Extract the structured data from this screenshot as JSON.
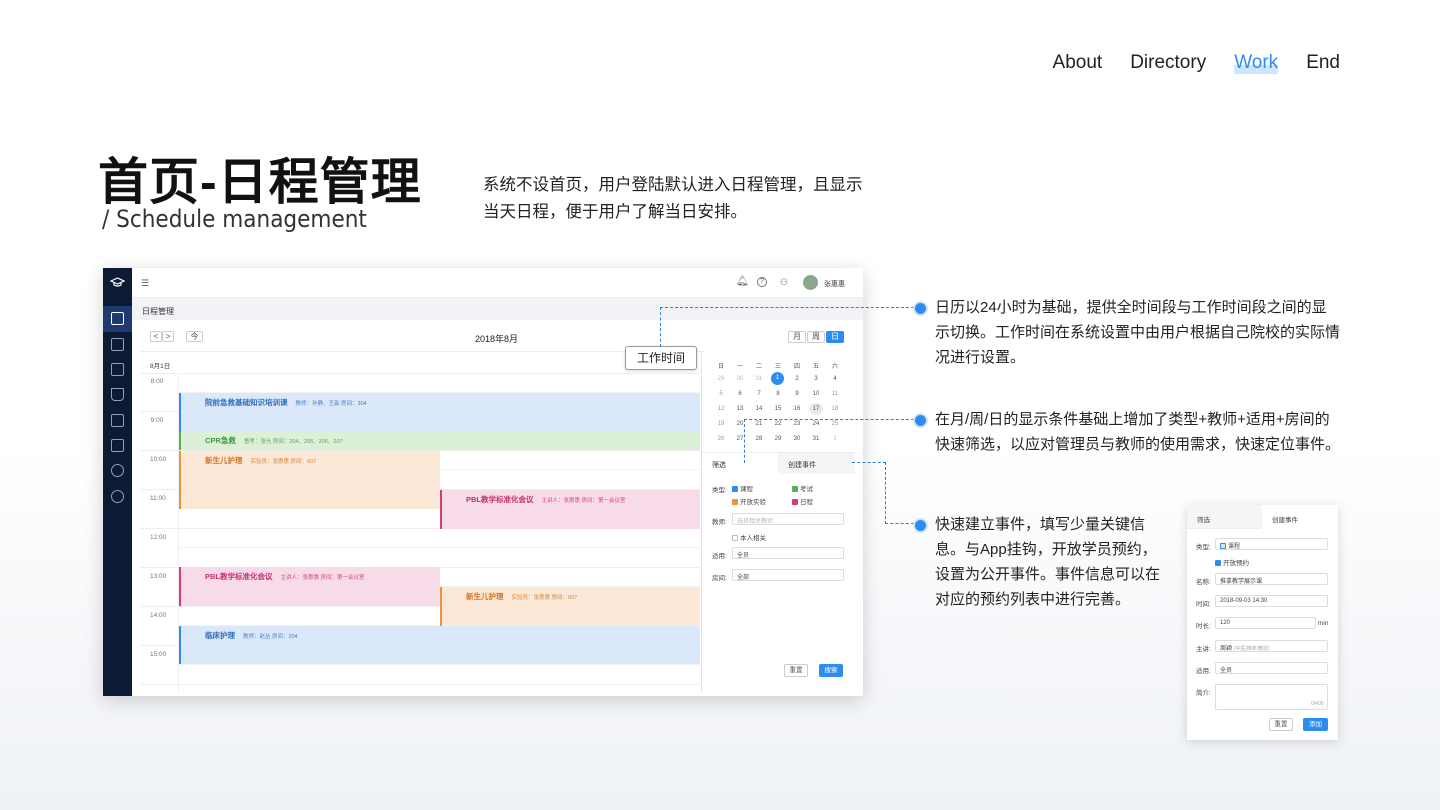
{
  "nav": {
    "items": [
      "About",
      "Directory",
      "Work",
      "End"
    ],
    "active": "Work"
  },
  "header": {
    "title": "首页-日程管理",
    "subtitle": "/   Schedule management"
  },
  "intro": "系统不设首页，用户登陆默认进入日程管理，且显示当天日程，便于用户了解当日安排。",
  "app": {
    "top_user": "张惠惠",
    "breadcrumb": "日程管理",
    "prev": "<",
    "next": ">",
    "today": "今",
    "month_title": "2018年8月",
    "views": [
      "月",
      "周",
      "日"
    ],
    "date_label": "8月1日",
    "times": [
      "8:00",
      "9:00",
      "10:00",
      "11:00",
      "12:00",
      "13:00",
      "14:00",
      "15:00"
    ],
    "events": [
      {
        "title": "院前急救基础知识培训课",
        "meta": "教师：孙静、王淼    房间：304"
      },
      {
        "title": "CPR急救",
        "meta": "督考：张允    房间：204、205、206、207"
      },
      {
        "title": "新生儿护理",
        "meta": "实验员：张惠惠    房间：607"
      },
      {
        "title": "PBL教学标准化会议",
        "meta": "主讲人：张惠惠    房间：第一会议室"
      },
      {
        "title": "PBL教学标准化会议",
        "meta": "主讲人：张惠惠    房间：第一会议室"
      },
      {
        "title": "新生儿护理",
        "meta": "实验员：张惠惠    房间：607"
      },
      {
        "title": "临床护理",
        "meta": "教师：赵丛    房间：204"
      }
    ],
    "mini_calendar": {
      "weekdays": [
        "日",
        "一",
        "二",
        "三",
        "四",
        "五",
        "六"
      ],
      "weeks": [
        [
          "29",
          "30",
          "31",
          "1",
          "2",
          "3",
          "4"
        ],
        [
          "5",
          "6",
          "7",
          "8",
          "9",
          "10",
          "11"
        ],
        [
          "12",
          "13",
          "14",
          "15",
          "16",
          "17",
          "18"
        ],
        [
          "19",
          "20",
          "21",
          "22",
          "23",
          "24",
          "25"
        ],
        [
          "26",
          "27",
          "28",
          "29",
          "30",
          "31",
          "1"
        ]
      ]
    },
    "tabs": [
      "筛选",
      "创建事件"
    ],
    "filter": {
      "type_label": "类型:",
      "types": [
        "课程",
        "考试",
        "开放实验",
        "日程"
      ],
      "teacher_label": "教师:",
      "teacher_placeholder": "选择相关教师",
      "self_related": "本人相关",
      "apply_label": "适用:",
      "apply_value": "全员",
      "room_label": "房间:",
      "room_value": "全部",
      "reset": "重置",
      "search": "搜索"
    }
  },
  "tooltip": "工作时间",
  "notes": [
    "日历以24小时为基础，提供全时间段与工作时间段之间的显示切换。工作时间在系统设置中由用户根据自己院校的实际情况进行设置。",
    "在月/周/日的显示条件基础上增加了类型+教师+适用+房间的快速筛选，以应对管理员与教师的使用需求，快速定位事件。",
    "快速建立事件，填写少量关键信息。与App挂钩，开放学员预约，设置为公开事件。事件信息可以在对应的预约列表中进行完善。"
  ],
  "create_card": {
    "tabs": [
      "筛选",
      "创建事件"
    ],
    "type_label": "类型:",
    "type_value": "课程",
    "open_booking": "开放预约",
    "name_label": "名称:",
    "name_value": "推拿教学展示课",
    "time_label": "时间:",
    "time_value": "2018-09-03  14:30",
    "duration_label": "时长:",
    "duration_value": "120",
    "duration_unit": "min",
    "speaker_label": "主讲:",
    "speaker_value": "周颖",
    "speaker_hint": "(中医/推拿/教授)",
    "apply_label": "适用:",
    "apply_value": "全员",
    "intro_label": "简介:",
    "intro_counter": "0/400",
    "reset": "重置",
    "add": "添加"
  },
  "colors": {
    "accent": "#2d8cf0",
    "sidebar": "#0d1a33"
  }
}
